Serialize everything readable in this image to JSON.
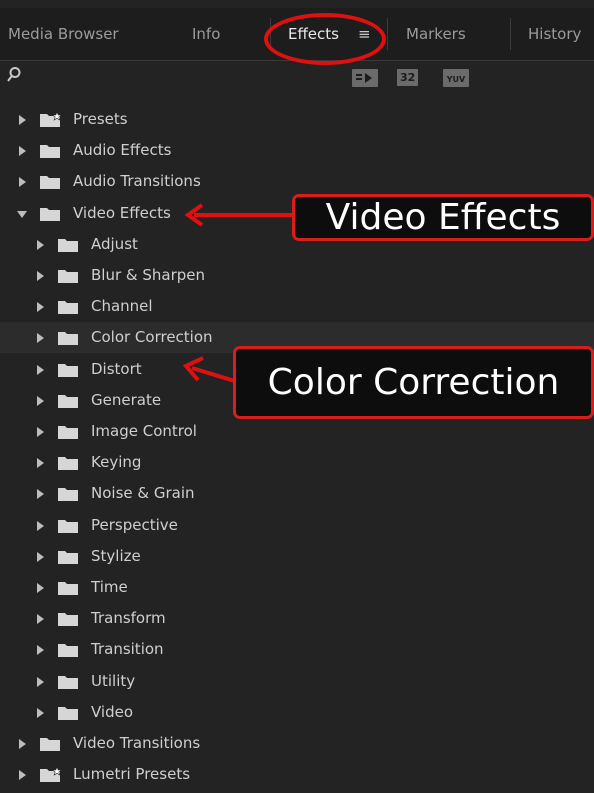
{
  "tabs": [
    {
      "label": "Media Browser",
      "active": false
    },
    {
      "label": "Info",
      "active": false
    },
    {
      "label": "Effects",
      "active": true
    },
    {
      "label": "Markers",
      "active": false
    },
    {
      "label": "History",
      "active": false
    }
  ],
  "toolbar": {
    "badges": [
      "32"
    ]
  },
  "tree": [
    {
      "label": "Presets",
      "level": 0,
      "icon": "preset-folder-icon",
      "expanded": false
    },
    {
      "label": "Audio Effects",
      "level": 0,
      "icon": "folder-icon",
      "expanded": false
    },
    {
      "label": "Audio Transitions",
      "level": 0,
      "icon": "folder-icon",
      "expanded": false
    },
    {
      "label": "Video Effects",
      "level": 0,
      "icon": "folder-icon",
      "expanded": true
    },
    {
      "label": "Adjust",
      "level": 1,
      "icon": "folder-icon",
      "expanded": false
    },
    {
      "label": "Blur & Sharpen",
      "level": 1,
      "icon": "folder-icon",
      "expanded": false
    },
    {
      "label": "Channel",
      "level": 1,
      "icon": "folder-icon",
      "expanded": false
    },
    {
      "label": "Color Correction",
      "level": 1,
      "icon": "folder-icon",
      "expanded": false,
      "highlighted": true
    },
    {
      "label": "Distort",
      "level": 1,
      "icon": "folder-icon",
      "expanded": false
    },
    {
      "label": "Generate",
      "level": 1,
      "icon": "folder-icon",
      "expanded": false
    },
    {
      "label": "Image Control",
      "level": 1,
      "icon": "folder-icon",
      "expanded": false
    },
    {
      "label": "Keying",
      "level": 1,
      "icon": "folder-icon",
      "expanded": false
    },
    {
      "label": "Noise & Grain",
      "level": 1,
      "icon": "folder-icon",
      "expanded": false
    },
    {
      "label": "Perspective",
      "level": 1,
      "icon": "folder-icon",
      "expanded": false
    },
    {
      "label": "Stylize",
      "level": 1,
      "icon": "folder-icon",
      "expanded": false
    },
    {
      "label": "Time",
      "level": 1,
      "icon": "folder-icon",
      "expanded": false
    },
    {
      "label": "Transform",
      "level": 1,
      "icon": "folder-icon",
      "expanded": false
    },
    {
      "label": "Transition",
      "level": 1,
      "icon": "folder-icon",
      "expanded": false
    },
    {
      "label": "Utility",
      "level": 1,
      "icon": "folder-icon",
      "expanded": false
    },
    {
      "label": "Video",
      "level": 1,
      "icon": "folder-icon",
      "expanded": false
    },
    {
      "label": "Video Transitions",
      "level": 0,
      "icon": "folder-icon",
      "expanded": false
    },
    {
      "label": "Lumetri Presets",
      "level": 0,
      "icon": "preset-folder-icon",
      "expanded": false
    }
  ],
  "annotations": {
    "video_effects": "Video Effects",
    "color_correction": "Color Correction"
  },
  "colors": {
    "panel_bg": "#232323",
    "annotation_red": "#e01010"
  }
}
